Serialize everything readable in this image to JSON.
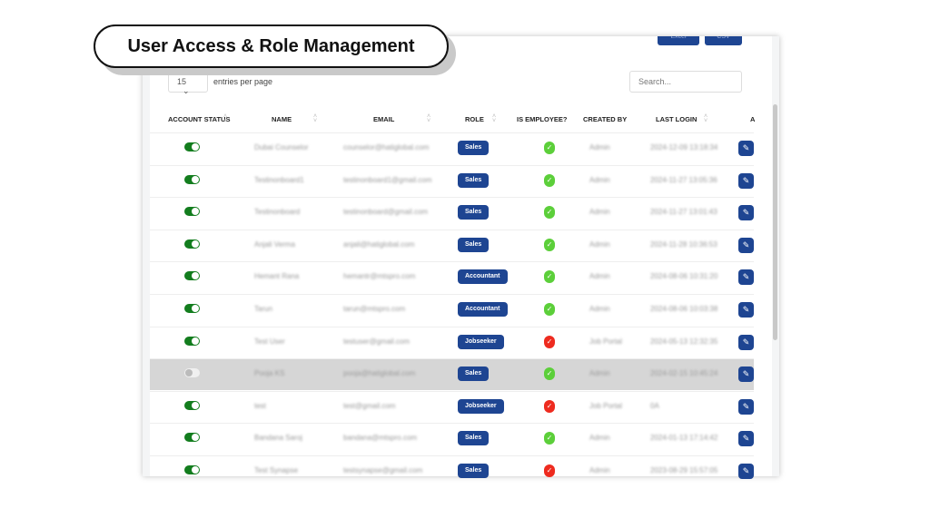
{
  "banner": {
    "title": "User Access & Role Management"
  },
  "toolbar": {
    "buttons": [
      "Excel",
      "CSV"
    ],
    "page_size": "15",
    "entries_label": "entries per page",
    "search_placeholder": "Search..."
  },
  "table": {
    "columns": [
      "ACCOUNT STATUS",
      "NAME",
      "EMAIL",
      "ROLE",
      "IS EMPLOYEE?",
      "CREATED BY",
      "LAST LOGIN",
      "A"
    ],
    "rows": [
      {
        "active": true,
        "name": "Dubai Counselor",
        "email": "counselor@hatiglobal.com",
        "role": "Sales",
        "employee": true,
        "created_by": "Admin",
        "last_login": "2024-12-09 13:18:34"
      },
      {
        "active": true,
        "name": "Testinonboard1",
        "email": "testinonboard1@gmail.com",
        "role": "Sales",
        "employee": true,
        "created_by": "Admin",
        "last_login": "2024-11-27 13:05:36"
      },
      {
        "active": true,
        "name": "Testinonboard",
        "email": "testinonboard@gmail.com",
        "role": "Sales",
        "employee": true,
        "created_by": "Admin",
        "last_login": "2024-11-27 13:01:43"
      },
      {
        "active": true,
        "name": "Anjali Verma",
        "email": "anjali@hatiglobal.com",
        "role": "Sales",
        "employee": true,
        "created_by": "Admin",
        "last_login": "2024-11-28 10:36:53"
      },
      {
        "active": true,
        "name": "Hemant Rana",
        "email": "hemantr@mtspro.com",
        "role": "Accountant",
        "employee": true,
        "created_by": "Admin",
        "last_login": "2024-08-06 10:31:20"
      },
      {
        "active": true,
        "name": "Tarun",
        "email": "tarun@mtspro.com",
        "role": "Accountant",
        "employee": true,
        "created_by": "Admin",
        "last_login": "2024-08-06 10:03:38"
      },
      {
        "active": true,
        "name": "Test User",
        "email": "testuser@gmail.com",
        "role": "Jobseeker",
        "employee": false,
        "created_by": "Job Portal",
        "last_login": "2024-05-13 12:32:35"
      },
      {
        "active": false,
        "name": "Pooja KS",
        "email": "pooja@hatiglobal.com",
        "role": "Sales",
        "employee": true,
        "created_by": "Admin",
        "last_login": "2024-02-15 10:45:24"
      },
      {
        "active": true,
        "name": "test",
        "email": "test@gmail.com",
        "role": "Jobseeker",
        "employee": false,
        "created_by": "Job Portal",
        "last_login": "0A"
      },
      {
        "active": true,
        "name": "Bandana Saroj",
        "email": "bandana@mtspro.com",
        "role": "Sales",
        "employee": true,
        "created_by": "Admin",
        "last_login": "2024-01-13 17:14:42"
      },
      {
        "active": true,
        "name": "Test Synapse",
        "email": "testsynapse@gmail.com",
        "role": "Sales",
        "employee": false,
        "created_by": "Admin",
        "last_login": "2023-08-29 15:57:05"
      }
    ]
  },
  "colors": {
    "brand": "#1e4592",
    "toggle_on": "#137d1e",
    "employee_yes": "#5ccf3a",
    "employee_no": "#ee2b1f"
  }
}
